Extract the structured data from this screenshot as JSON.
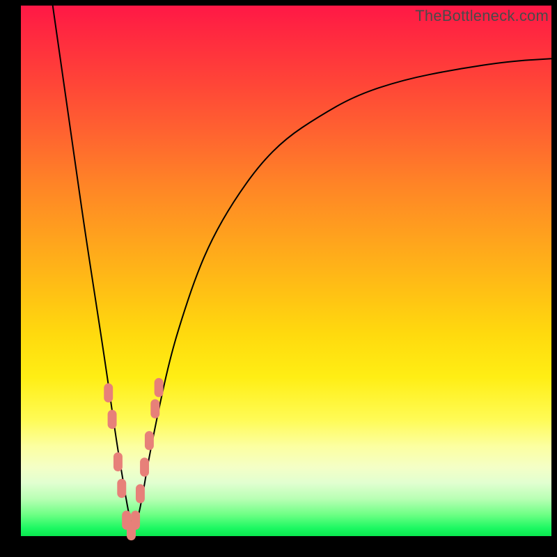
{
  "watermark": "TheBottleneck.com",
  "colors": {
    "frame": "#000000",
    "curve": "#000000",
    "marker": "#e78079",
    "gradient_top": "#ff1846",
    "gradient_bottom": "#0ae84f"
  },
  "chart_data": {
    "type": "line",
    "title": "",
    "xlabel": "",
    "ylabel": "",
    "xlim": [
      0,
      100
    ],
    "ylim": [
      0,
      100
    ],
    "x_unlabeled": true,
    "y_unlabeled": true,
    "series": [
      {
        "name": "bottleneck-curve",
        "x": [
          6,
          8,
          10,
          12,
          14,
          16,
          18,
          19,
          20,
          21,
          22,
          23,
          24,
          26,
          28,
          30,
          33,
          36,
          40,
          45,
          50,
          56,
          63,
          72,
          82,
          92,
          100
        ],
        "y": [
          100,
          86,
          72,
          58,
          45,
          32,
          18,
          12,
          6,
          1,
          3,
          8,
          14,
          24,
          33,
          40,
          49,
          56,
          63,
          70,
          75,
          79,
          83,
          86,
          88,
          89.5,
          90
        ]
      }
    ],
    "markers": {
      "name": "highlighted-points",
      "shape": "rounded-pill",
      "x": [
        16.5,
        17.2,
        18.3,
        19.0,
        19.9,
        20.8,
        21.6,
        22.5,
        23.3,
        24.2,
        25.3,
        26.0
      ],
      "y": [
        27,
        22,
        14,
        9,
        3,
        1,
        3,
        8,
        13,
        18,
        24,
        28
      ]
    },
    "notes": "No axes, ticks, or numeric labels are rendered in the image; values are estimated from relative pixel positions on a 0–100 normalized scale. Curve minimum (bottleneck ≈ 0%) lies near x ≈ 21."
  }
}
